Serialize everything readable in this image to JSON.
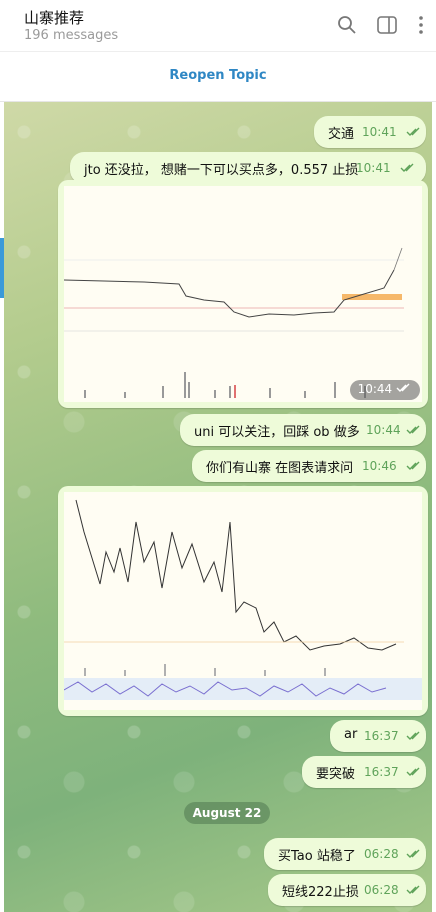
{
  "header": {
    "title": "山寨推荐",
    "subtitle": "196 messages"
  },
  "topic_bar": {
    "label": "Reopen Topic"
  },
  "messages": [
    {
      "text": "交通",
      "time": "10:41"
    },
    {
      "text": "jto 还没拉， 想赌一下可以买点多，0.557 止损",
      "time": "10:41"
    },
    {
      "text": "",
      "time": "10:44"
    },
    {
      "text": "uni 可以关注，回踩 ob 做多",
      "time": "10:44"
    },
    {
      "text": "你们有山寨 在图表请求问",
      "time": "10:46"
    },
    {
      "text": "ar",
      "time": "16:37"
    },
    {
      "text": "要突破",
      "time": "16:37"
    },
    {
      "text": "买Tao 站稳了",
      "time": "06:28"
    },
    {
      "text": "短线222止损",
      "time": "06:28"
    }
  ],
  "date_separator": "August 22"
}
